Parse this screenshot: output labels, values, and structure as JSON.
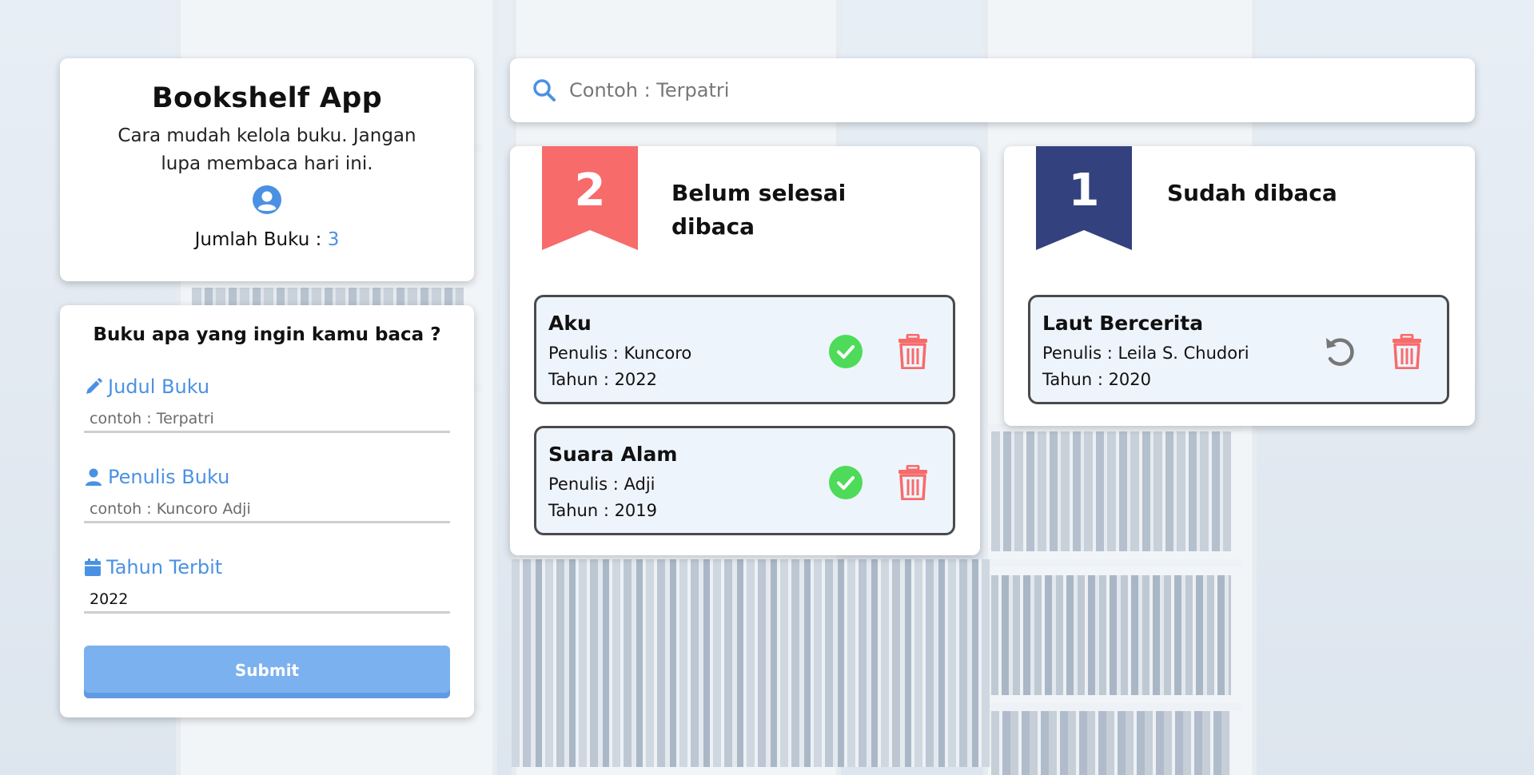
{
  "colors": {
    "accent": "#4b91e3",
    "danger": "#f76b6b",
    "success": "#4ddb59",
    "navy": "#33427e",
    "ribbon_red": "#f76b6b"
  },
  "header": {
    "title": "Bookshelf App",
    "subtitle": "Cara mudah kelola buku. Jangan lupa membaca hari ini.",
    "icon": "user-circle-icon",
    "count_label": "Jumlah Buku :",
    "count_value": "3"
  },
  "form": {
    "heading": "Buku apa yang ingin kamu baca ?",
    "title_field": {
      "icon": "pencil-icon",
      "label": "Judul Buku",
      "placeholder": "contoh : Terpatri",
      "value": ""
    },
    "author_field": {
      "icon": "user-icon",
      "label": "Penulis Buku",
      "placeholder": "contoh : Kuncoro Adji",
      "value": ""
    },
    "year_field": {
      "icon": "calendar-icon",
      "label": "Tahun Terbit",
      "placeholder": "",
      "value": "2022"
    },
    "submit_label": "Submit"
  },
  "search": {
    "icon": "search-icon",
    "placeholder": "Contoh : Terpatri"
  },
  "unfinished": {
    "count": "2",
    "title": "Belum selesai dibaca",
    "books": [
      {
        "title": "Aku",
        "author": "Penulis : Kuncoro",
        "year": "Tahun : 2022",
        "action_icon": "check-circle-icon",
        "delete_icon": "trash-icon"
      },
      {
        "title": "Suara Alam",
        "author": "Penulis : Adji",
        "year": "Tahun : 2019",
        "action_icon": "check-circle-icon",
        "delete_icon": "trash-icon"
      }
    ]
  },
  "finished": {
    "count": "1",
    "title": "Sudah dibaca",
    "books": [
      {
        "title": "Laut Bercerita",
        "author": "Penulis : Leila S. Chudori",
        "year": "Tahun : 2020",
        "action_icon": "undo-icon",
        "delete_icon": "trash-icon"
      }
    ]
  }
}
